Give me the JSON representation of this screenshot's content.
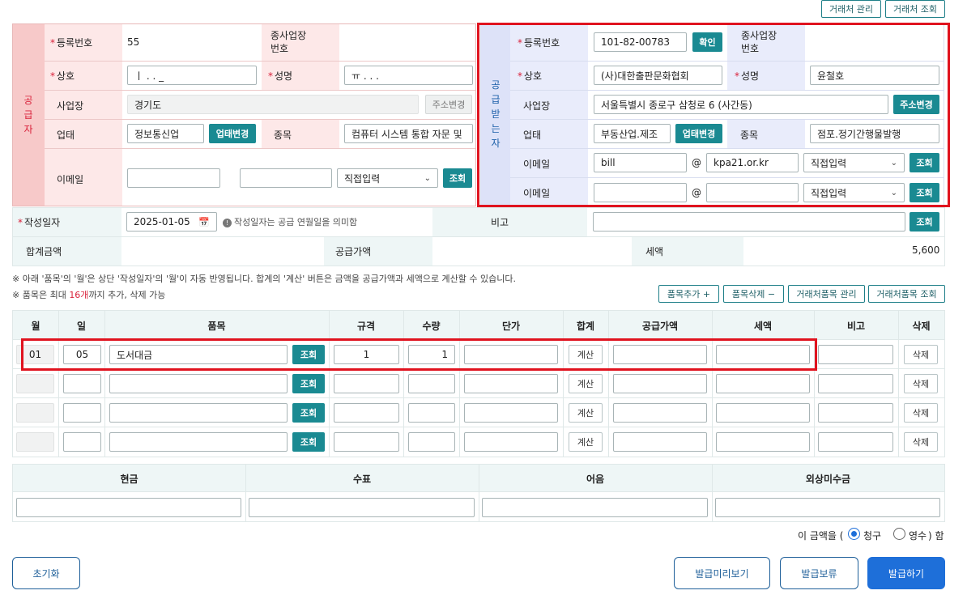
{
  "top_buttons": {
    "partner_manage": "거래처 관리",
    "partner_search": "거래처 조회"
  },
  "supplier": {
    "section_label": "공급자",
    "reg_no_label": "등록번호",
    "reg_no": "55",
    "branch_no_label": "종사업장\n번호",
    "company_label": "상호",
    "company": "ㅣ . . _",
    "name_label": "성명",
    "name": "ㅠ . . .",
    "address_label": "사업장",
    "address": "경기도",
    "address_change": "주소변경",
    "biz_type_label": "업태",
    "biz_type": "정보통신업",
    "biz_type_change": "업태변경",
    "biz_item_label": "종목",
    "biz_item": "컴퓨터 시스템 통합 자문 및",
    "email_label": "이메일",
    "email_select": "직접입력",
    "search": "조회"
  },
  "receiver": {
    "section_label": "공급받는자",
    "reg_no_label": "등록번호",
    "reg_no": "101-82-00783",
    "confirm": "확인",
    "branch_no_label": "종사업장\n번호",
    "company_label": "상호",
    "company": "(사)대한출판문화협회",
    "name_label": "성명",
    "name": "윤철호",
    "address_label": "사업장",
    "address": "서울특별시 종로구 삼청로 6 (사간동)",
    "address_change": "주소변경",
    "biz_type_label": "업태",
    "biz_type": "부동산업.제조",
    "biz_type_change": "업태변경",
    "biz_item_label": "종목",
    "biz_item": "점포.정기간행물발행",
    "email_label": "이메일",
    "email_user": "bill",
    "at": "@",
    "email_domain": "kpa21.or.kr",
    "email_select": "직접입력",
    "email2_label": "이메일",
    "email2_select": "직접입력",
    "search": "조회"
  },
  "meta": {
    "date_label": "작성일자",
    "date": "2025-01-05",
    "date_hint": "작성일자는 공급 연월일을 의미함",
    "remark_label": "비고",
    "search": "조회",
    "total_label": "합계금액",
    "supply_label": "공급가액",
    "tax_label": "세액",
    "tax_value": "5,600"
  },
  "notes": {
    "line1": "※ 아래 '품목'의 '월'은 상단 '작성일자'의 '월'이 자동 반영됩니다. 합계의 '계산' 버튼은 금액을 공급가액과 세액으로 계산할 수 있습니다.",
    "line2_prefix": "※ 품목은 최대 ",
    "line2_count": "16개",
    "line2_suffix": "까지 추가, 삭제 가능"
  },
  "item_buttons": {
    "add": "품목추가 +",
    "delete": "품목삭제 −",
    "manage": "거래처품목 관리",
    "search": "거래처품목 조회"
  },
  "items_header": [
    "월",
    "일",
    "품목",
    "규격",
    "수량",
    "단가",
    "합계",
    "공급가액",
    "세액",
    "비고",
    "삭제"
  ],
  "items": [
    {
      "month": "01",
      "day": "05",
      "name": "도서대금",
      "spec": "1",
      "qty": "1"
    },
    {
      "month": "",
      "day": "",
      "name": "",
      "spec": "",
      "qty": ""
    },
    {
      "month": "",
      "day": "",
      "name": "",
      "spec": "",
      "qty": ""
    },
    {
      "month": "",
      "day": "",
      "name": "",
      "spec": "",
      "qty": ""
    }
  ],
  "row_labels": {
    "search": "조회",
    "calc": "계산",
    "delete": "삭제"
  },
  "payment_header": [
    "현금",
    "수표",
    "어음",
    "외상미수금"
  ],
  "claim": {
    "prefix": "이 금액을 (",
    "claim": "청구",
    "receipt": "영수",
    "suffix": ") 함"
  },
  "footer": {
    "reset": "초기화",
    "preview": "발급미리보기",
    "hold": "발급보류",
    "issue": "발급하기"
  },
  "colors": {
    "accent": "#1a8a92",
    "supplier_bg": "#fde8e8",
    "receiver_bg": "#e9ecfb",
    "highlight": "#e0131f",
    "primary": "#1e6fd9"
  }
}
